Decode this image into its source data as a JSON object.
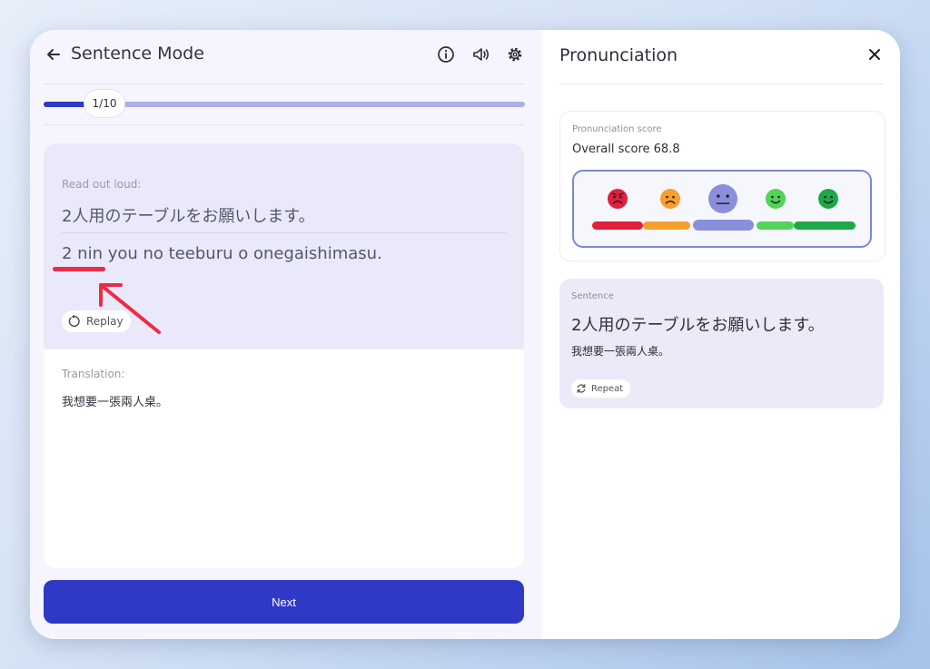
{
  "header": {
    "title": "Sentence Mode",
    "icons": [
      "back-arrow-icon",
      "info-icon",
      "speaker-icon",
      "gear-icon"
    ]
  },
  "progress": {
    "label": "1/10",
    "current": 1,
    "total": 10
  },
  "card": {
    "read_label": "Read out loud:",
    "japanese": "2人用のテーブルをお願いします。",
    "romaji": "2 nin you no teeburu o onegaishimasu.",
    "replay_label": "Replay",
    "translation_label": "Translation:",
    "translation": "我想要一張兩人桌。"
  },
  "next_label": "Next",
  "panel": {
    "title": "Pronunciation",
    "score_label": "Pronunciation score",
    "score_text": "Overall score 68.8",
    "score": 68.8,
    "selected_level": 3,
    "faces": [
      {
        "name": "very-bad-face-icon",
        "color": "#e0203c"
      },
      {
        "name": "bad-face-icon",
        "color": "#f5a02c"
      },
      {
        "name": "neutral-face-icon",
        "color": "#8a8fdc"
      },
      {
        "name": "good-face-icon",
        "color": "#52d35a"
      },
      {
        "name": "very-good-face-icon",
        "color": "#1ea84a"
      }
    ],
    "sentence_label": "Sentence",
    "sentence_jp": "2人用のテーブルをお願いします。",
    "sentence_tr": "我想要一張兩人桌。",
    "repeat_label": "Repeat"
  },
  "colors": {
    "accent": "#2f39c6",
    "annotation": "#ee2b44"
  }
}
